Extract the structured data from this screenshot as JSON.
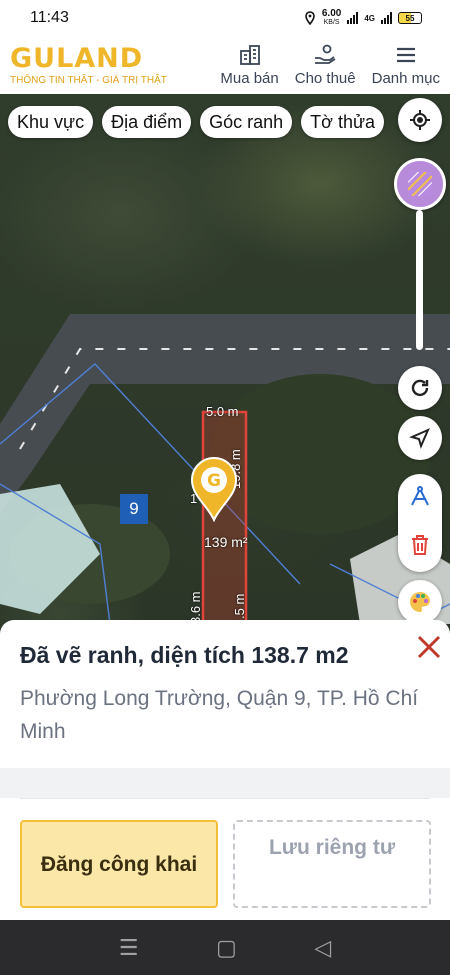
{
  "status_bar": {
    "time": "11:43",
    "net_speed_value": "6.00",
    "net_speed_unit": "KB/S",
    "network_label": "4G",
    "battery": "55"
  },
  "header": {
    "logo_text": "GULAND",
    "logo_tagline": "THÔNG TIN THẬT - GIÁ TRỊ THẬT",
    "nav": [
      {
        "label": "Mua bán",
        "icon": "building-icon"
      },
      {
        "label": "Cho thuê",
        "icon": "hand-key-icon"
      },
      {
        "label": "Danh mục",
        "icon": "hamburger-menu-icon"
      }
    ]
  },
  "filters": [
    "Khu vực",
    "Địa điểm",
    "Góc ranh",
    "Tờ thửa"
  ],
  "map": {
    "lot_number": "9",
    "plot_area_label": "139 m²",
    "width_top": "5.0 m",
    "depth_right": "19.8 m",
    "lower_left": "3.6 m",
    "lower_right": ".5 m",
    "left_partial": "1",
    "marker_letter": "G"
  },
  "sheet": {
    "title": "Đã vẽ ranh, diện tích 138.7 m2",
    "address": "Phường Long Trường, Quận 9, TP. Hồ Chí Minh",
    "public_button": "Đăng công khai",
    "private_button": "Lưu riêng tư"
  },
  "colors": {
    "brand": "#f0b62a",
    "plot_outline": "#e0443a",
    "close": "#c0392b"
  }
}
